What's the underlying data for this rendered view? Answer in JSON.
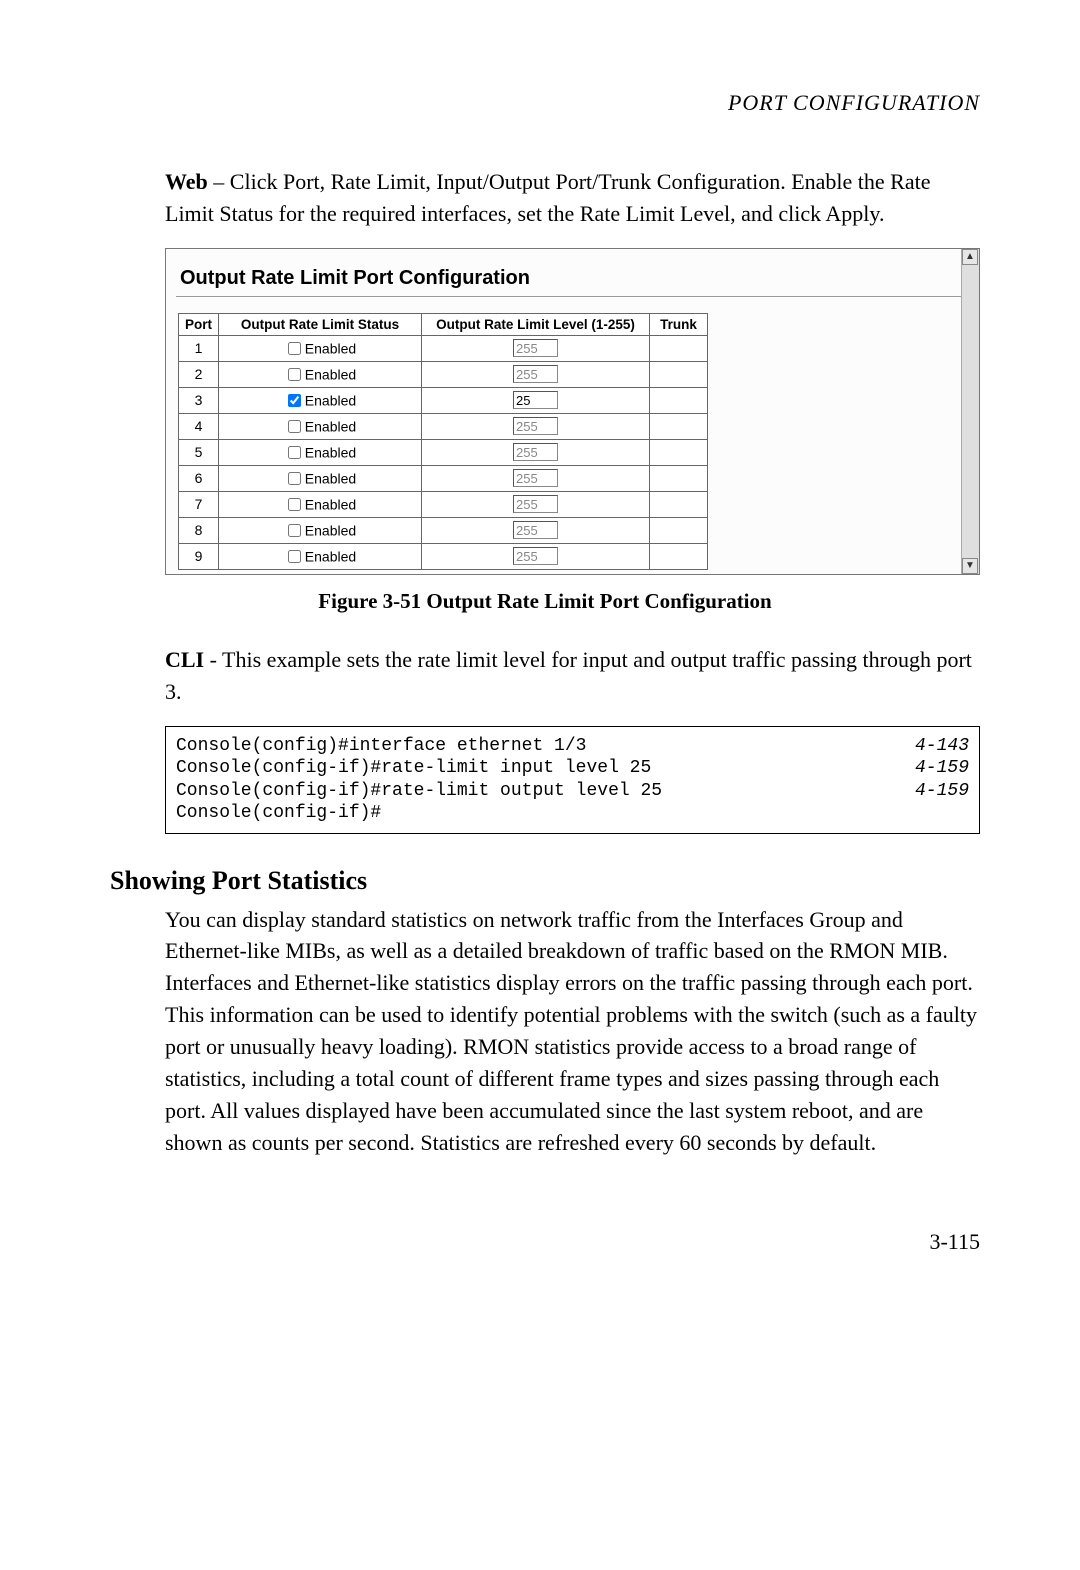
{
  "running_header": "PORT CONFIGURATION",
  "intro_lead": "Web",
  "intro_dash": " – ",
  "intro_rest": "Click Port, Rate Limit, Input/Output Port/Trunk Configuration. Enable the Rate Limit Status for the required interfaces, set the Rate Limit Level, and click Apply.",
  "panel": {
    "title": "Output Rate Limit Port Configuration",
    "headers": {
      "port": "Port",
      "status": "Output Rate Limit Status",
      "level": "Output Rate Limit Level (1-255)",
      "trunk": "Trunk"
    },
    "status_label": "Enabled",
    "rows": [
      {
        "port": "1",
        "checked": false,
        "level": "255",
        "trunk": ""
      },
      {
        "port": "2",
        "checked": false,
        "level": "255",
        "trunk": ""
      },
      {
        "port": "3",
        "checked": true,
        "level": "25",
        "trunk": ""
      },
      {
        "port": "4",
        "checked": false,
        "level": "255",
        "trunk": ""
      },
      {
        "port": "5",
        "checked": false,
        "level": "255",
        "trunk": ""
      },
      {
        "port": "6",
        "checked": false,
        "level": "255",
        "trunk": ""
      },
      {
        "port": "7",
        "checked": false,
        "level": "255",
        "trunk": ""
      },
      {
        "port": "8",
        "checked": false,
        "level": "255",
        "trunk": ""
      },
      {
        "port": "9",
        "checked": false,
        "level": "255",
        "trunk": ""
      }
    ]
  },
  "figure_caption": "Figure 3-51  Output Rate Limit Port Configuration",
  "cli_intro_lead": "CLI",
  "cli_intro_rest": " - This example sets the rate limit level for input and output traffic passing through port 3.",
  "cli": {
    "lines": [
      {
        "cmd": "Console(config)#interface ethernet 1/3",
        "ref": "4-143"
      },
      {
        "cmd": "Console(config-if)#rate-limit input level 25",
        "ref": "4-159"
      },
      {
        "cmd": "Console(config-if)#rate-limit output level 25",
        "ref": "4-159"
      },
      {
        "cmd": "Console(config-if)#",
        "ref": ""
      }
    ]
  },
  "section_heading": "Showing Port Statistics",
  "section_body": "You can display standard statistics on network traffic from the Interfaces Group and Ethernet-like MIBs, as well as a detailed breakdown of traffic based on the RMON MIB. Interfaces and Ethernet-like statistics display errors on the traffic passing through each port. This information can be used to identify potential problems with the switch (such as a faulty port or unusually heavy loading). RMON statistics provide access to a broad range of statistics, including a total count of different frame types and sizes passing through each port. All values displayed have been accumulated since the last system reboot, and are shown as counts per second. Statistics are refreshed every 60 seconds by default.",
  "page_number": "3-115"
}
